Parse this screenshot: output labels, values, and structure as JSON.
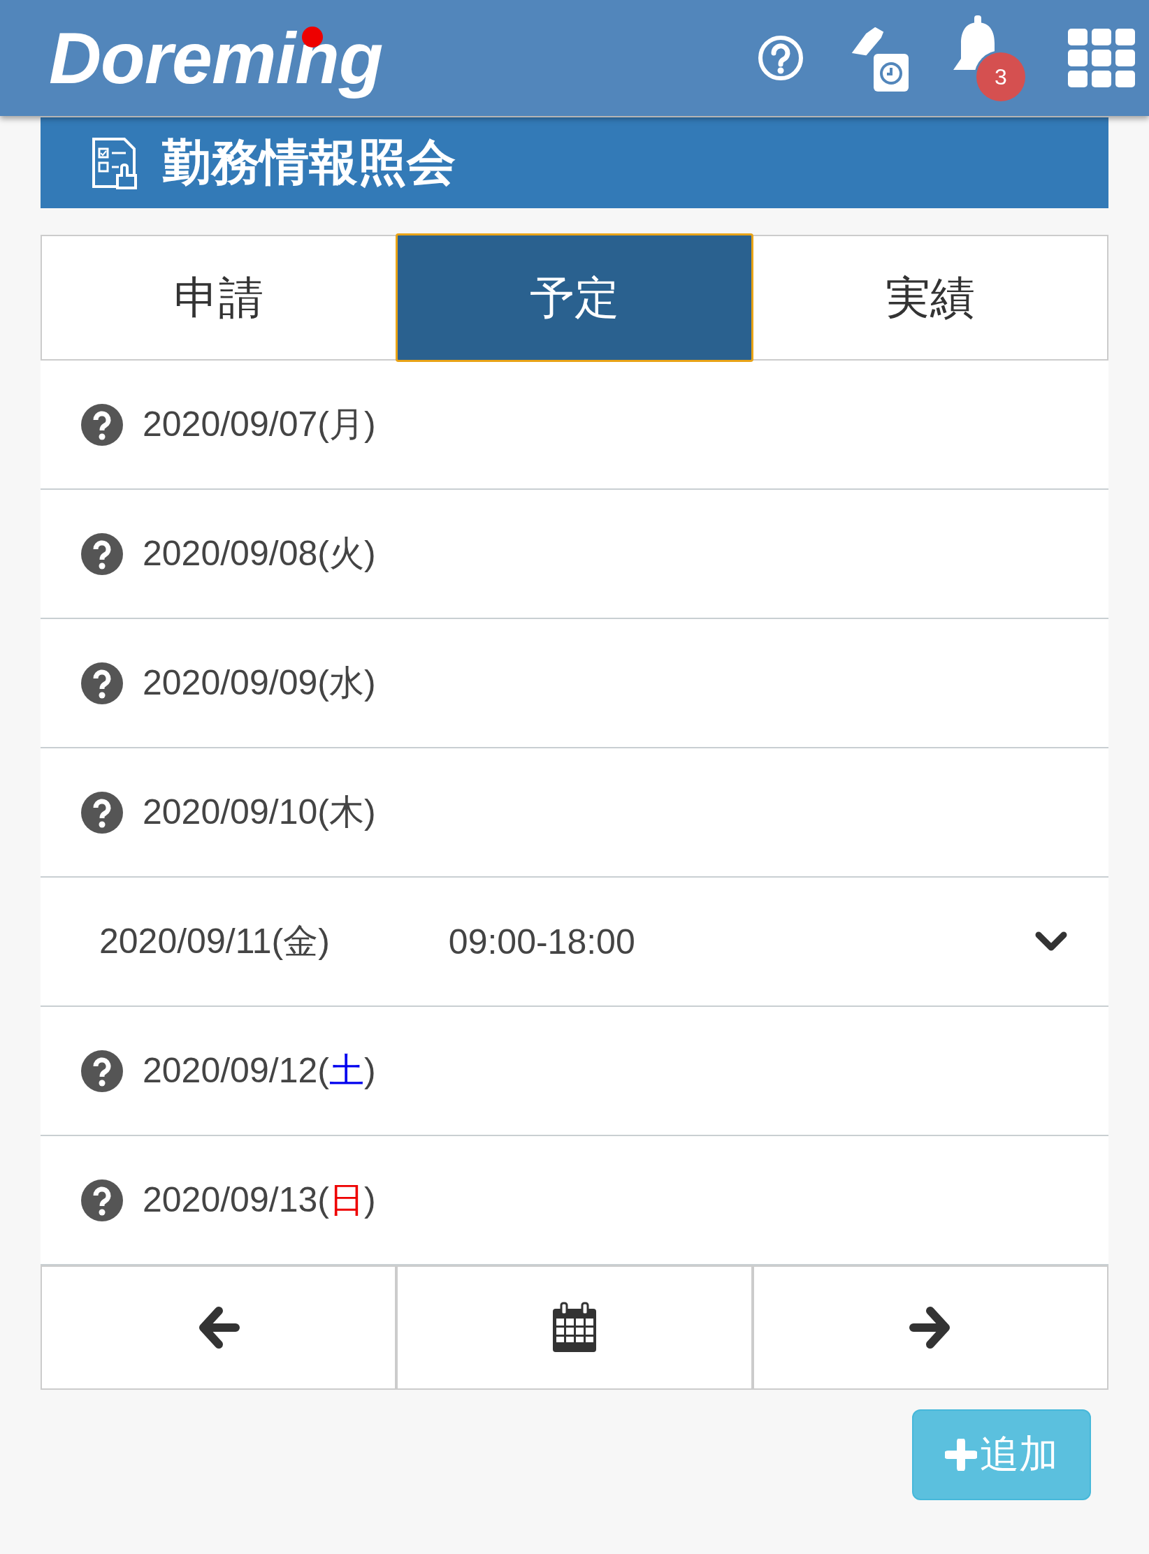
{
  "header": {
    "logo": "Doreming",
    "notification_count": "3"
  },
  "page_title": "勤務情報照会",
  "tabs": [
    {
      "label": "申請",
      "selected": false
    },
    {
      "label": "予定",
      "selected": true
    },
    {
      "label": "実績",
      "selected": false
    }
  ],
  "weekday_brackets": [
    "(",
    ")"
  ],
  "days": [
    {
      "kind": "unknown",
      "date": "2020/09/07",
      "weekday": "月",
      "color": "#444444"
    },
    {
      "kind": "unknown",
      "date": "2020/09/08",
      "weekday": "火",
      "color": "#444444"
    },
    {
      "kind": "unknown",
      "date": "2020/09/09",
      "weekday": "水",
      "color": "#444444"
    },
    {
      "kind": "unknown",
      "date": "2020/09/10",
      "weekday": "木",
      "color": "#444444"
    },
    {
      "kind": "scheduled",
      "date": "2020/09/11",
      "weekday": "金",
      "color": "#444444",
      "time": "09:00-18:00",
      "expanded": false
    },
    {
      "kind": "unknown",
      "date": "2020/09/12",
      "weekday": "土",
      "color": "#0000ee"
    },
    {
      "kind": "unknown",
      "date": "2020/09/13",
      "weekday": "日",
      "color": "#ee0000"
    }
  ],
  "add_button": "追加"
}
